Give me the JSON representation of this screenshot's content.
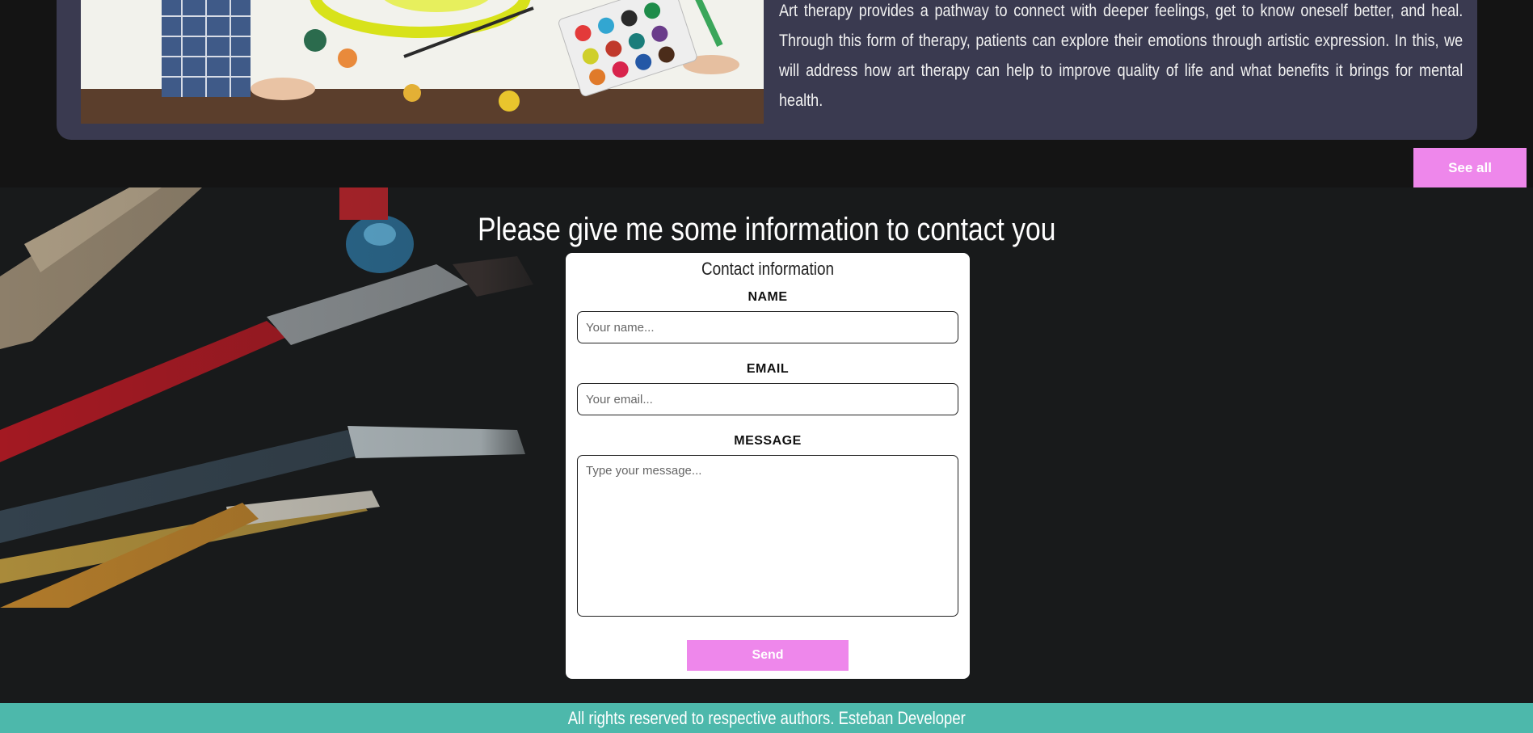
{
  "article": {
    "description": "Art therapy provides a pathway to connect with deeper feelings, get to know oneself better, and heal. Through this form of therapy, patients can explore their emotions through artistic expression. In this, we will address how art therapy can help to improve quality of life and what benefits it brings for mental health."
  },
  "see_all_label": "See all",
  "contact": {
    "heading": "Please give me some information to contact you",
    "form_title": "Contact information",
    "name_label": "NAME",
    "name_placeholder": "Your name...",
    "email_label": "EMAIL",
    "email_placeholder": "Your email...",
    "message_label": "MESSAGE",
    "message_placeholder": "Type your message...",
    "send_label": "Send"
  },
  "footer": {
    "text": "All rights reserved to respective authors. Esteban Developer"
  },
  "colors": {
    "accent_pink": "#ee87eb",
    "footer_teal": "#4db8ab",
    "card_bg": "#3a3a50",
    "page_bg": "#141414"
  }
}
